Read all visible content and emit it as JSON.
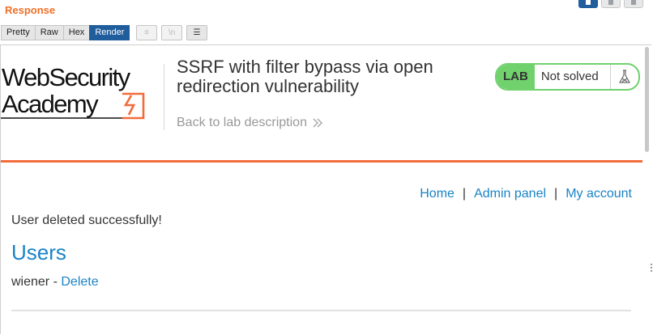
{
  "response_panel": {
    "title": "Response",
    "view_tabs": [
      {
        "label": "Pretty",
        "active": false
      },
      {
        "label": "Raw",
        "active": false
      },
      {
        "label": "Hex",
        "active": false
      },
      {
        "label": "Render",
        "active": true
      }
    ],
    "tools": [
      {
        "icon": "wrap-lines-icon",
        "glyph": "≡",
        "enabled": false
      },
      {
        "icon": "newline-icon",
        "glyph": "\\n",
        "enabled": false
      },
      {
        "icon": "menu-icon",
        "glyph": "☰",
        "enabled": true
      }
    ],
    "layout_buttons": [
      "layout-split-icon",
      "layout-horizontal-icon",
      "layout-single-icon"
    ]
  },
  "page": {
    "logo": {
      "line1": "WebSecurity",
      "line2": "Academy"
    },
    "lab_title": "SSRF with filter bypass via open redirection vulnerability",
    "back_link": "Back to lab description",
    "status": {
      "badge": "LAB",
      "state": "Not solved"
    },
    "nav": {
      "home": "Home",
      "admin": "Admin panel",
      "account": "My account",
      "separator": "|"
    },
    "message": "User deleted successfully!",
    "users_heading": "Users",
    "users": [
      {
        "name": "wiener",
        "separator": " - ",
        "action": "Delete"
      }
    ]
  },
  "colors": {
    "accent_orange": "#f26b3a",
    "link_blue": "#1a83c6",
    "lab_green": "#70d16d",
    "tab_active": "#1f5d9c",
    "response_title": "#f07028"
  }
}
